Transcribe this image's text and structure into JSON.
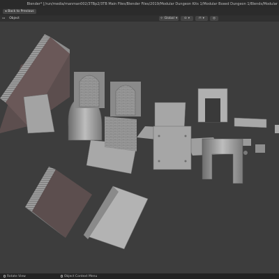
{
  "window": {
    "title": "Blender* [/run/media/manman002/3TBp2/3TB Main Files/Blender Files/2019/Modular Dungeon Kits 1/Modular Boxed Dungeon 1/Blends/Modular"
  },
  "toolbar": {
    "back_label": "Back to Previous"
  },
  "header": {
    "menu_object": "Object",
    "orientation_label": "Global"
  },
  "statusbar": {
    "rotate_view": "Rotate View",
    "context_menu": "Object Context Menu"
  },
  "colors": {
    "viewport_bg": "#3d3d3d",
    "mesh_light": "#a8a8a8",
    "mesh_mid": "#8a8a8a",
    "mesh_dark": "#5a4c4c"
  }
}
